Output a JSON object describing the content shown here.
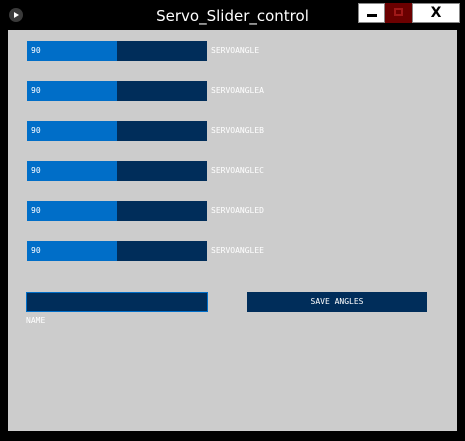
{
  "window": {
    "title": "Servo_Slider_control",
    "minimize_icon": "minimize-icon",
    "maximize_icon": "maximize-icon",
    "close_label": "X"
  },
  "sliders": [
    {
      "value": "90",
      "label": "SERVOANGLE",
      "fraction": 0.5
    },
    {
      "value": "90",
      "label": "SERVOANGLEA",
      "fraction": 0.5
    },
    {
      "value": "90",
      "label": "SERVOANGLEB",
      "fraction": 0.5
    },
    {
      "value": "90",
      "label": "SERVOANGLEC",
      "fraction": 0.5
    },
    {
      "value": "90",
      "label": "SERVOANGLED",
      "fraction": 0.5
    },
    {
      "value": "90",
      "label": "SERVOANGLEE",
      "fraction": 0.5
    }
  ],
  "name_field": {
    "value": "",
    "label": "NAME"
  },
  "save_button": {
    "label": "SAVE ANGLES"
  },
  "colors": {
    "background": "#cccccc",
    "track": "#002d5a",
    "fill": "#006ec8",
    "text": "#ffffff"
  }
}
